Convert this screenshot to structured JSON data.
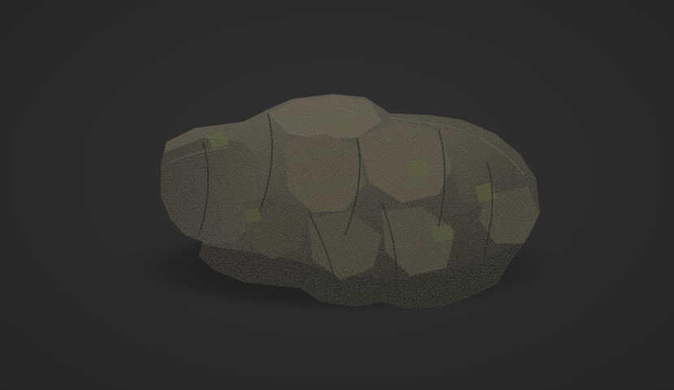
{
  "scene": {
    "subject": "rock-model",
    "colors": {
      "background": "#2a2a2b",
      "rock_base": "#4a463c",
      "rock_light": "#6f6a5a",
      "rock_dark": "#2c2a25",
      "moss": "#59603a",
      "shadow": "#1e1e1f"
    }
  }
}
